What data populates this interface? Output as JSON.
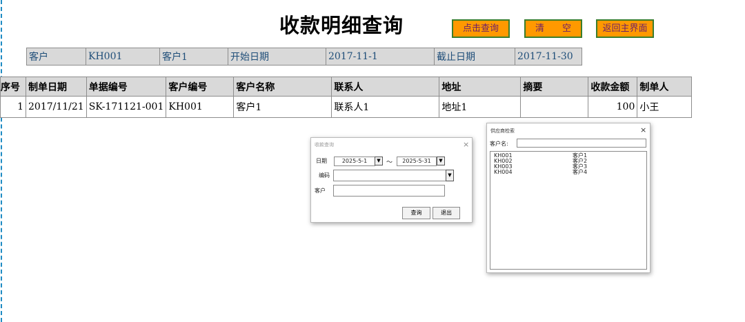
{
  "page_title": "收款明细查询",
  "buttons": {
    "query": "点击查询",
    "clear": "清　　空",
    "back": "返回主界面"
  },
  "query_bar": {
    "customer_label": "客户",
    "customer_code": "KH001",
    "customer_name": "客户1",
    "start_label": "开始日期",
    "start_date": "2017-11-1",
    "end_label": "截止日期",
    "end_date": "2017-11-30"
  },
  "table": {
    "headers": [
      "序号",
      "制单日期",
      "单据编号",
      "客户编号",
      "客户名称",
      "联系人",
      "地址",
      "摘要",
      "收款金额",
      "制单人"
    ],
    "rows": [
      [
        "1",
        "2017/11/21",
        "SK-171121-001",
        "KH001",
        "客户1",
        "联系人1",
        "地址1",
        "",
        "100",
        "小王"
      ]
    ]
  },
  "dialog_receipt": {
    "title": "收款查询",
    "date_label": "日期",
    "date_from": "2025-5-1",
    "tilde": "～",
    "date_to": "2025-5-31",
    "code_label": "编码",
    "code_value": "",
    "customer_label": "客户",
    "customer_value": "",
    "query_button": "查询",
    "exit_button": "退出"
  },
  "dialog_supplier": {
    "title": "供应商检索",
    "search_label": "客户名:",
    "search_value": "",
    "items": [
      {
        "code": "KH001",
        "name": "客户1"
      },
      {
        "code": "KH002",
        "name": "客户2"
      },
      {
        "code": "KH003",
        "name": "客户3"
      },
      {
        "code": "KH004",
        "name": "客户4"
      }
    ]
  }
}
